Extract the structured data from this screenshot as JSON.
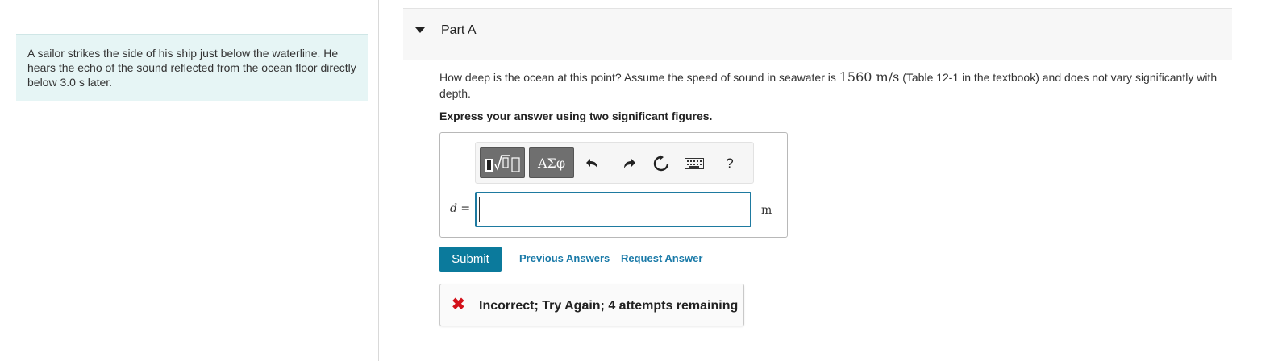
{
  "problem": {
    "text": "A sailor strikes the side of his ship just below the waterline. He hears the echo of the sound reflected from the ocean floor directly below 3.0 s later."
  },
  "part": {
    "title": "Part A"
  },
  "question": {
    "before": "How deep is the ocean at this point? Assume the speed of sound in seawater is ",
    "speed_value": "1560 m/s",
    "after": " (Table 12-1 in the textbook) and does not vary significantly with depth."
  },
  "instruction": "Express your answer using two significant figures.",
  "toolbar": {
    "symbols_label": "ΑΣφ",
    "help_label": "?"
  },
  "answer": {
    "variable": "d",
    "equals": " =",
    "value": "",
    "unit": "m"
  },
  "actions": {
    "submit_label": "Submit",
    "previous_answers_label": "Previous Answers",
    "request_answer_label": "Request Answer"
  },
  "feedback": {
    "text": "Incorrect; Try Again; 4 attempts remaining",
    "color": "#d3121b"
  },
  "colors": {
    "accent": "#0b7a9c",
    "problem_bg": "#e6f5f5"
  }
}
